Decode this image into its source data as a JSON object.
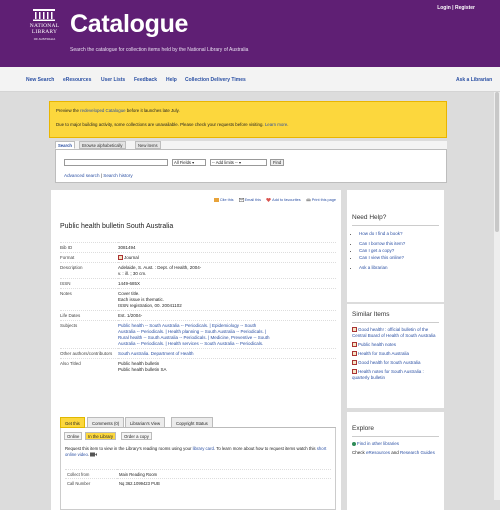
{
  "header": {
    "logo_text": "NATIONAL LIBRARY",
    "logo_sub": "OF AUSTRALIA",
    "title": "Catalogue",
    "tagline": "Search the catalogue for collection items held by the National Library of Australia",
    "login_label": "Login",
    "separator": " | ",
    "register_label": "Register"
  },
  "nav": {
    "items": [
      "New Search",
      "eResources",
      "User Lists",
      "Feedback",
      "Help",
      "Collection Delivery Times"
    ],
    "right_item": "Ask a Librarian"
  },
  "notice": {
    "line1_pre": "Preview the ",
    "line1_link": "redeveloped Catalogue",
    "line1_post": " before it launches late July.",
    "line2_pre": "Due to major building activity, some collections are unavailable. Please check your requests before visiting. ",
    "line2_link": "Learn more",
    "line2_post": "."
  },
  "search": {
    "tabs": [
      "Search",
      "Browse alphabetically",
      "New items"
    ],
    "input_value": "",
    "field_select": "All Fields",
    "limit_select": "-- Add limits --",
    "find_label": "Find",
    "advanced_link": "Advanced search",
    "link_sep": " | ",
    "history_link": "Search history"
  },
  "tools": {
    "cite": "Cite this",
    "email": "Email this",
    "favourites": "Add to favourites",
    "print": "Print this page"
  },
  "record": {
    "title": "Public health bulletin South Australia",
    "rows": [
      {
        "label": "Bib ID",
        "lines": [
          "3081494"
        ]
      },
      {
        "label": "Format",
        "lines": [
          "Journal"
        ]
      },
      {
        "label": "Description",
        "lines": [
          "Adelaide, S. Aust. : Dept. of Health, 2004-",
          "v. : ill. ; 30 cm."
        ]
      },
      {
        "label": "ISSN",
        "lines": [
          "1449-685X"
        ]
      },
      {
        "label": "Notes",
        "lines": [
          "Cover title.",
          "Each issue is thematic.",
          "ISSN registration, 00. 20041102"
        ]
      },
      {
        "label": "Life Dates",
        "lines": [
          "Est. 1/2004-"
        ]
      },
      {
        "label": "Subjects",
        "lines": [
          "Public health -- South Australia -- Periodicals. | Epidemiology -- South",
          "Australia -- Periodicals. | Health planning -- South Australia -- Periodicals. |",
          "Rural health -- South Australia -- Periodicals. | Medicine, Preventive -- South",
          "Australia -- Periodicals. | Health services -- South Australia -- Periodicals."
        ]
      },
      {
        "label": "Other authors/contributors",
        "lines": [
          "South Australia. Department of Health"
        ]
      },
      {
        "label": "Also Titled",
        "lines": [
          "Public health bulletin",
          "Public health bulletin SA"
        ]
      }
    ]
  },
  "detail": {
    "tabs": [
      "Get this",
      "Comments (0)",
      "Librarian's View",
      "Copyright Status"
    ],
    "sub_tabs": [
      "Online",
      "In the Library",
      "Order a copy"
    ],
    "text_pre": "Request this item to view in the Library's reading rooms using your ",
    "text_link1": "library card",
    "text_mid": ". To learn more about how to request items watch this ",
    "text_link2": "short online video",
    "text_post": ".",
    "holdings": [
      {
        "label": "Collect from",
        "value": "Main Reading Room"
      },
      {
        "label": "Call Number",
        "value": "Nq 362.1099423 PUB"
      }
    ]
  },
  "sidebar": {
    "help_title": "Need Help?",
    "help_items": [
      "How do I find a book?",
      "Can I borrow this item?",
      "Can I get a copy?",
      "Can I view this online?",
      "Ask a librarian"
    ],
    "similar_title": "Similar Items",
    "similar_items": [
      "Good health! : official bulletin of the Central Board of Health of South Australia",
      "Public health notes",
      "Health for South Australia",
      "Good health for South Australia",
      "Health notes for South Australia : quarterly bulletin"
    ],
    "explore_title": "Explore",
    "explore_other": "Find in other libraries",
    "explore_pre": "Check ",
    "explore_link1": "eResources",
    "explore_mid": " and ",
    "explore_link2": "Research Guides"
  },
  "colors": {
    "header_purple": "#5f1f74",
    "notice_yellow": "#fcd73d",
    "link_blue": "#2a4fa3"
  }
}
